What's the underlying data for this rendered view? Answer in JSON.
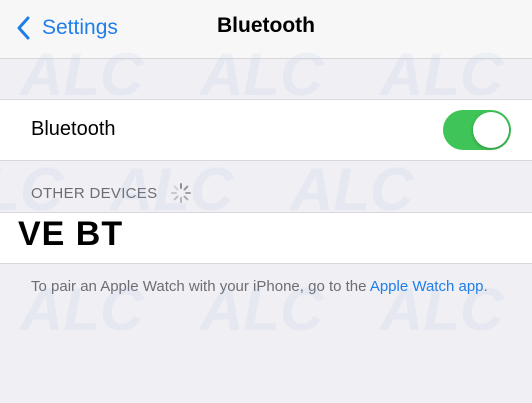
{
  "navbar": {
    "back_label": "Settings",
    "title": "Bluetooth"
  },
  "bluetooth_row": {
    "label": "Bluetooth",
    "toggle_on": true
  },
  "other_devices": {
    "header": "OTHER DEVICES"
  },
  "overlay": {
    "text": "VE BT"
  },
  "footer": {
    "text": "To pair an Apple Watch with your iPhone, go to the ",
    "link": "Apple Watch app",
    "suffix": "."
  },
  "watermark": {
    "text": "ALC"
  },
  "colors": {
    "accent": "#1f7ee8",
    "toggle_on": "#3fc557",
    "background": "#efeff4"
  }
}
